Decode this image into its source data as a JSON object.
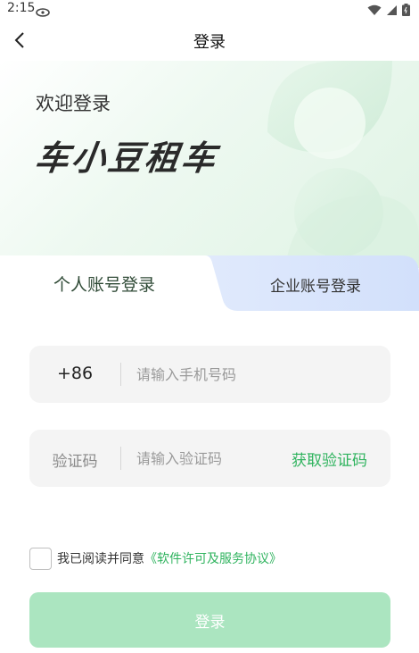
{
  "status_bar": {
    "time": "2:15"
  },
  "nav": {
    "title": "登录"
  },
  "banner": {
    "welcome": "欢迎登录",
    "brand": "车小豆租车"
  },
  "tabs": {
    "personal": "个人账号登录",
    "enterprise": "企业账号登录"
  },
  "phone_field": {
    "prefix": "+86",
    "placeholder": "请输入手机号码",
    "value": ""
  },
  "code_field": {
    "label": "验证码",
    "placeholder": "请输入验证码",
    "value": "",
    "get_code": "获取验证码"
  },
  "agreement": {
    "text": "我已阅读并同意",
    "link": "《软件许可及服务协议》",
    "checked": false
  },
  "login_button": {
    "label": "登录"
  },
  "colors": {
    "accent": "#2fb35e",
    "button_disabled": "#abe5c0",
    "field_bg": "#f4f4f4",
    "banner_green": "#dff3e4",
    "tab_blue": "#dbe6fb"
  }
}
